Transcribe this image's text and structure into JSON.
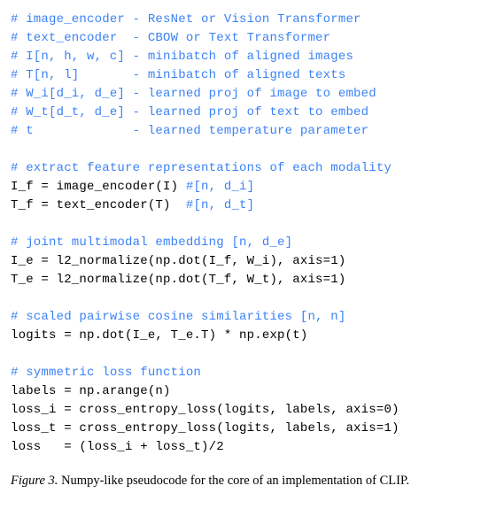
{
  "code": {
    "lines": [
      {
        "type": "comment",
        "text": "# image_encoder - ResNet or Vision Transformer"
      },
      {
        "type": "comment",
        "text": "# text_encoder  - CBOW or Text Transformer"
      },
      {
        "type": "comment",
        "text": "# I[n, h, w, c] - minibatch of aligned images"
      },
      {
        "type": "comment",
        "text": "# T[n, l]       - minibatch of aligned texts"
      },
      {
        "type": "comment",
        "text": "# W_i[d_i, d_e] - learned proj of image to embed"
      },
      {
        "type": "comment",
        "text": "# W_t[d_t, d_e] - learned proj of text to embed"
      },
      {
        "type": "comment",
        "text": "# t             - learned temperature parameter"
      },
      {
        "type": "blank",
        "text": ""
      },
      {
        "type": "comment",
        "text": "# extract feature representations of each modality"
      },
      {
        "type": "code-with-comment",
        "code": "I_f = image_encoder(I) ",
        "comment": "#[n, d_i]"
      },
      {
        "type": "code-with-comment",
        "code": "T_f = text_encoder(T)  ",
        "comment": "#[n, d_t]"
      },
      {
        "type": "blank",
        "text": ""
      },
      {
        "type": "comment",
        "text": "# joint multimodal embedding [n, d_e]"
      },
      {
        "type": "code",
        "text": "I_e = l2_normalize(np.dot(I_f, W_i), axis=1)"
      },
      {
        "type": "code",
        "text": "T_e = l2_normalize(np.dot(T_f, W_t), axis=1)"
      },
      {
        "type": "blank",
        "text": ""
      },
      {
        "type": "comment",
        "text": "# scaled pairwise cosine similarities [n, n]"
      },
      {
        "type": "code",
        "text": "logits = np.dot(I_e, T_e.T) * np.exp(t)"
      },
      {
        "type": "blank",
        "text": ""
      },
      {
        "type": "comment",
        "text": "# symmetric loss function"
      },
      {
        "type": "code",
        "text": "labels = np.arange(n)"
      },
      {
        "type": "code",
        "text": "loss_i = cross_entropy_loss(logits, labels, axis=0)"
      },
      {
        "type": "code",
        "text": "loss_t = cross_entropy_loss(logits, labels, axis=1)"
      },
      {
        "type": "code",
        "text": "loss   = (loss_i + loss_t)/2"
      }
    ]
  },
  "caption": {
    "label": "Figure 3.",
    "text": " Numpy-like pseudocode for the core of an implementation of CLIP."
  }
}
